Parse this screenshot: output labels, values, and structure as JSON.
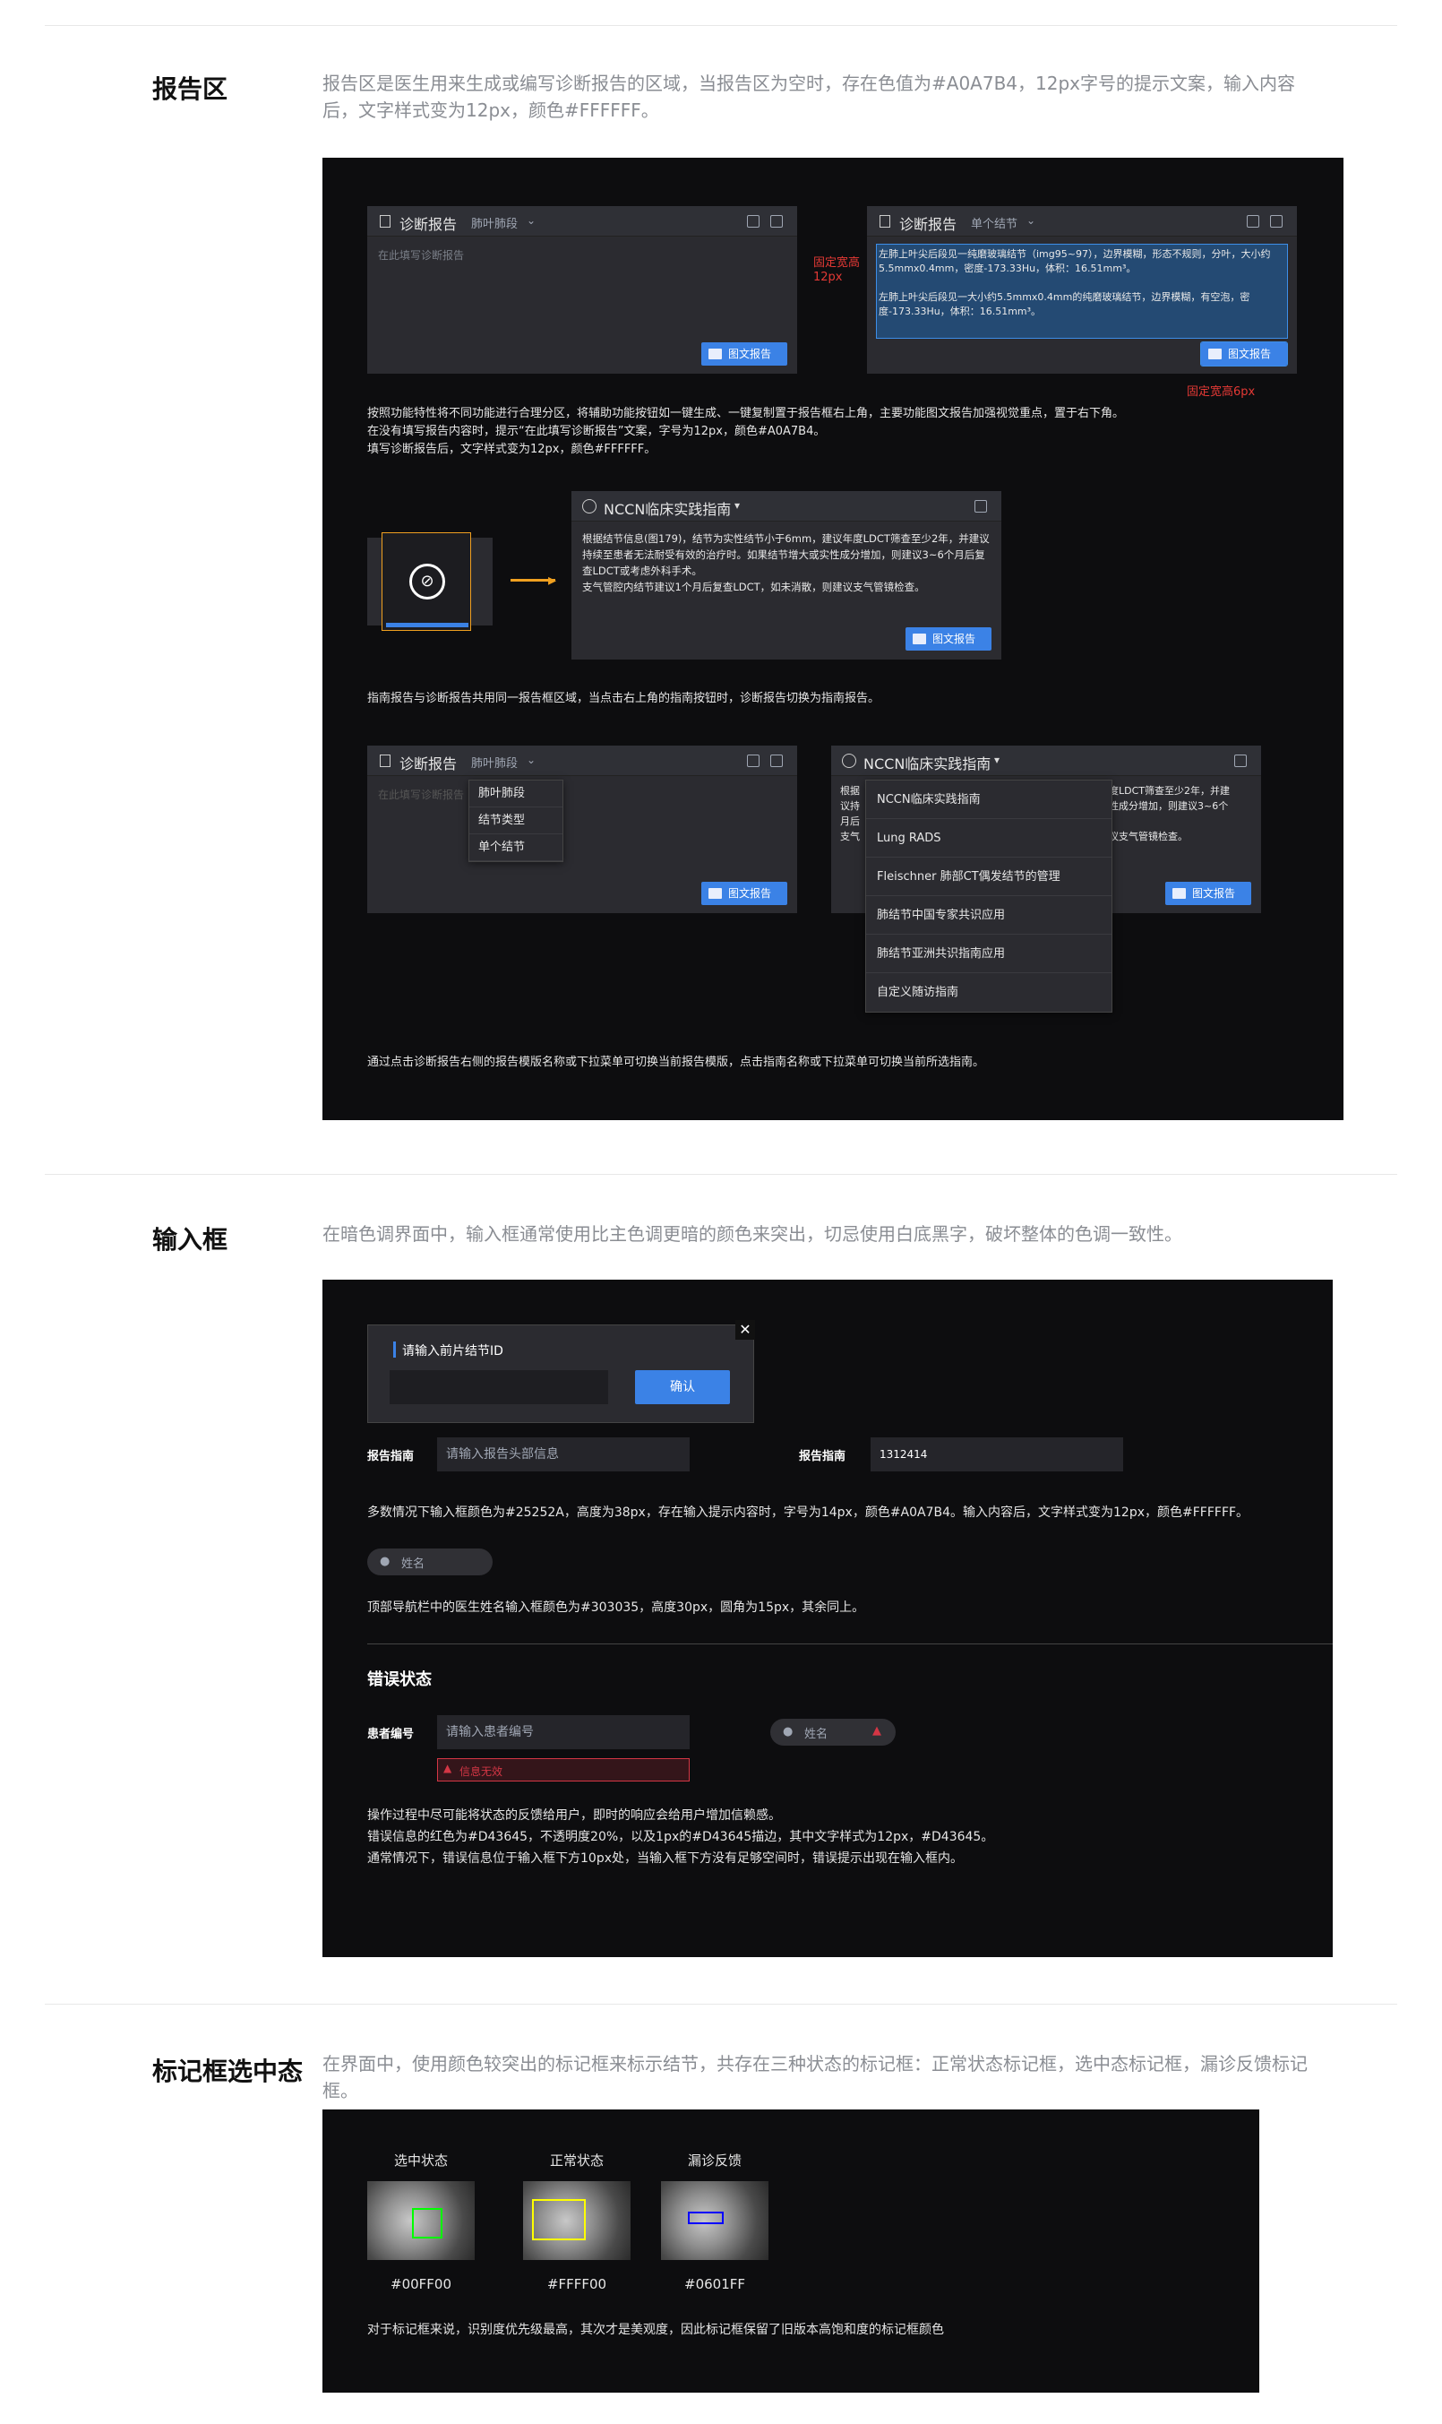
{
  "report_section": {
    "title": "报告区",
    "desc": "报告区是医生用来生成或编写诊断报告的区域，当报告区为空时，存在色值为#A0A7B4，12px字号的提示文案，输入内容后，文字样式变为12px，颜色#FFFFFF。",
    "panel_empty": {
      "title": "诊断报告",
      "template": "肺叶肺段",
      "placeholder": "在此填写诊断报告",
      "button": "图文报告"
    },
    "panel_filled": {
      "title": "诊断报告",
      "template": "单个结节",
      "text": "左肺上叶尖后段见一纯磨玻璃结节（img95~97），边界模糊，形态不规则，分叶，大小约5.5mmx0.4mm，密度-173.33Hu，体积：16.51mm³。\n\n左肺上叶尖后段见一大小约5.5mmx0.4mm的纯磨玻璃结节，边界模糊，有空泡，密度-173.33Hu，体积：16.51mm³。",
      "button": "图文报告"
    },
    "ann_fixed_width": "固定宽高",
    "ann_12px": "12px",
    "ann_6px": "固定宽高6px",
    "note1": "按照功能特性将不同功能进行合理分区，将辅助功能按钮如一键生成、一键复制置于报告框右上角，主要功能图文报告加强视觉重点，置于右下角。\n在没有填写报告内容时，提示“在此填写诊断报告”文案，字号为12px，颜色#A0A7B4。\n填写诊断报告后，文字样式变为12px，颜色#FFFFFF。",
    "guide_panel": {
      "title": "NCCN临床实践指南",
      "text": "根据结节信息(图179)，结节为实性结节小于6mm，建议年度LDCT筛查至少2年，并建议持续至患者无法耐受有效的治疗时。如果结节增大或实性成分增加，则建议3~6个月后复查LDCT或考虑外科手术。\n支气管腔内结节建议1个月后复查LDCT，如未消散，则建议支气管镜检查。",
      "button": "图文报告"
    },
    "note2": "指南报告与诊断报告共用同一报告框区域，当点击右上角的指南按钮时，诊断报告切换为指南报告。",
    "dd_left": {
      "title": "诊断报告",
      "template": "肺叶肺段",
      "placeholder": "在此填写诊断报告",
      "button": "图文报告",
      "options": [
        "肺叶肺段",
        "结节类型",
        "单个结节"
      ]
    },
    "dd_right": {
      "title": "NCCN临床实践指南",
      "partial_left": "根据\n议持\n月后\n支气",
      "partial_right": "度LDCT筛查至少2年，并建\n性成分增加，则建议3~6个\n\n议支气管镜检查。",
      "button": "图文报告",
      "options": [
        "NCCN临床实践指南",
        "Lung RADS",
        "Fleischner 肺部CT偶发结节的管理",
        "肺结节中国专家共识应用",
        "肺结节亚洲共识指南应用",
        "自定义随访指南"
      ]
    },
    "note3": "通过点击诊断报告右侧的报告模版名称或下拉菜单可切换当前报告模版，点击指南名称或下拉菜单可切换当前所选指南。"
  },
  "input_section": {
    "title": "输入框",
    "desc": "在暗色调界面中，输入框通常使用比主色调更暗的颜色来突出，切忌使用白底黑字，破坏整体的色调一致性。",
    "dialog": {
      "label": "请输入前片结节ID",
      "confirm": "确认"
    },
    "field1": {
      "label": "报告指南",
      "placeholder": "请输入报告头部信息"
    },
    "field2": {
      "label": "报告指南",
      "value": "1312414"
    },
    "note1": "多数情况下输入框颜色为#25252A，高度为38px，存在输入提示内容时，字号为14px，颜色#A0A7B4。输入内容后，文字样式变为12px，颜色#FFFFFF。",
    "name_pill": "姓名",
    "note2": "顶部导航栏中的医生姓名输入框颜色为#303035，高度30px，圆角为15px，其余同上。",
    "error_title": "错误状态",
    "error_field": {
      "label": "患者编号",
      "placeholder": "请输入患者编号",
      "error": "信息无效"
    },
    "error_pill": "姓名",
    "note3": "操作过程中尽可能将状态的反馈给用户，即时的响应会给用户增加信赖感。\n错误信息的红色为#D43645，不透明度20%，以及1px的#D43645描边，其中文字样式为12px，#D43645。\n通常情况下，错误信息位于输入框下方10px处，当输入框下方没有足够空间时，错误提示出现在输入框内。"
  },
  "marker_section": {
    "title": "标记框选中态",
    "desc": "在界面中，使用颜色较突出的标记框来标示结节，共存在三种状态的标记框：正常状态标记框，选中态标记框，漏诊反馈标记框。",
    "items": [
      {
        "label": "选中状态",
        "color_text": "#00FF00",
        "color": "#00ff00"
      },
      {
        "label": "正常状态",
        "color_text": "#FFFF00",
        "color": "#ffff00"
      },
      {
        "label": "漏诊反馈",
        "color_text": "#0601FF",
        "color": "#0601ff"
      }
    ],
    "note": "对于标记框来说，识别度优先级最高，其次才是美观度，因此标记框保留了旧版本高饱和度的标记框颜色"
  }
}
